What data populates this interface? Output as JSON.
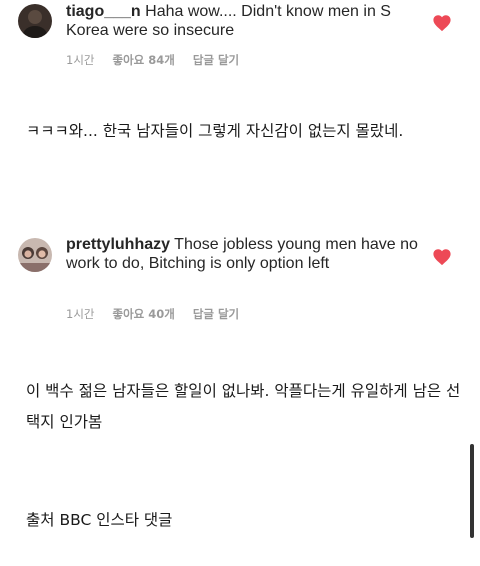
{
  "comments": [
    {
      "username": "tiago___n",
      "text": " Haha wow.... Didn't know men in S Korea were so insecure",
      "time": "1시간",
      "likes": "좋아요 84개",
      "reply": "답글 달기",
      "liked": true
    },
    {
      "username": "prettyluhhazy",
      "text": " Those jobless young men have no work to do, Bitching is only option left",
      "time": "1시간",
      "likes": "좋아요 40개",
      "reply": "답글 달기",
      "liked": true
    }
  ],
  "translations": [
    "ㅋㅋㅋ와... 한국 남자들이 그렇게 자신감이 없는지 몰랐네.",
    "이 백수 젊은 남자들은 할일이 없나봐. 악플다는게 유일하게 남은 선택지 인가봄"
  ],
  "source": "출처 BBC 인스타 댓글",
  "colors": {
    "heart": "#ed4956",
    "meta": "#9a9a9a"
  }
}
